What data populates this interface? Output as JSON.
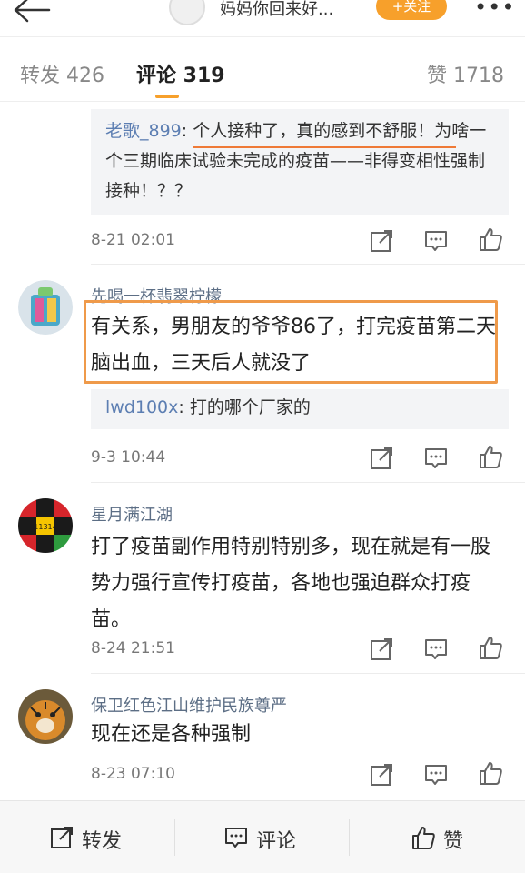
{
  "header": {
    "title": "妈妈你回来好...",
    "follow_label": "+关注",
    "more_label": "•••"
  },
  "tabs": {
    "repost": "转发 426",
    "comment": "评论 319",
    "like": "赞 1718"
  },
  "comments": [
    {
      "reply_user": "老歌_899",
      "reply_text": ": 个人接种了，真的感到不舒服！为啥一个三期临床试验未完成的疫苗——非得变相性强制接种！？？",
      "time": "8-21 02:01"
    },
    {
      "username": "先喝一杯翡翠柠檬",
      "text": "有关系，男朋友的爷爷86了，打完疫苗第二天脑出血，三天后人就没了",
      "reply_user": "lwd100x",
      "reply_text": ": 打的哪个厂家的",
      "time": "9-3 10:44"
    },
    {
      "username": "星月满江湖",
      "text": "打了疫苗副作用特别特别多，现在就是有一股势力强行宣传打疫苗，各地也强迫群众打疫苗。",
      "avatar_label": "11314",
      "time": "8-24 21:51"
    },
    {
      "username": "保卫红色江山维护民族尊严",
      "text": "现在还是各种强制",
      "time": "8-23 07:10"
    }
  ],
  "bottom_bar": {
    "repost": "转发",
    "comment": "评论",
    "like": "赞"
  },
  "colors": {
    "accent": "#f7a02b",
    "username": "#5c6e85",
    "highlight": "#ef9a4a"
  }
}
